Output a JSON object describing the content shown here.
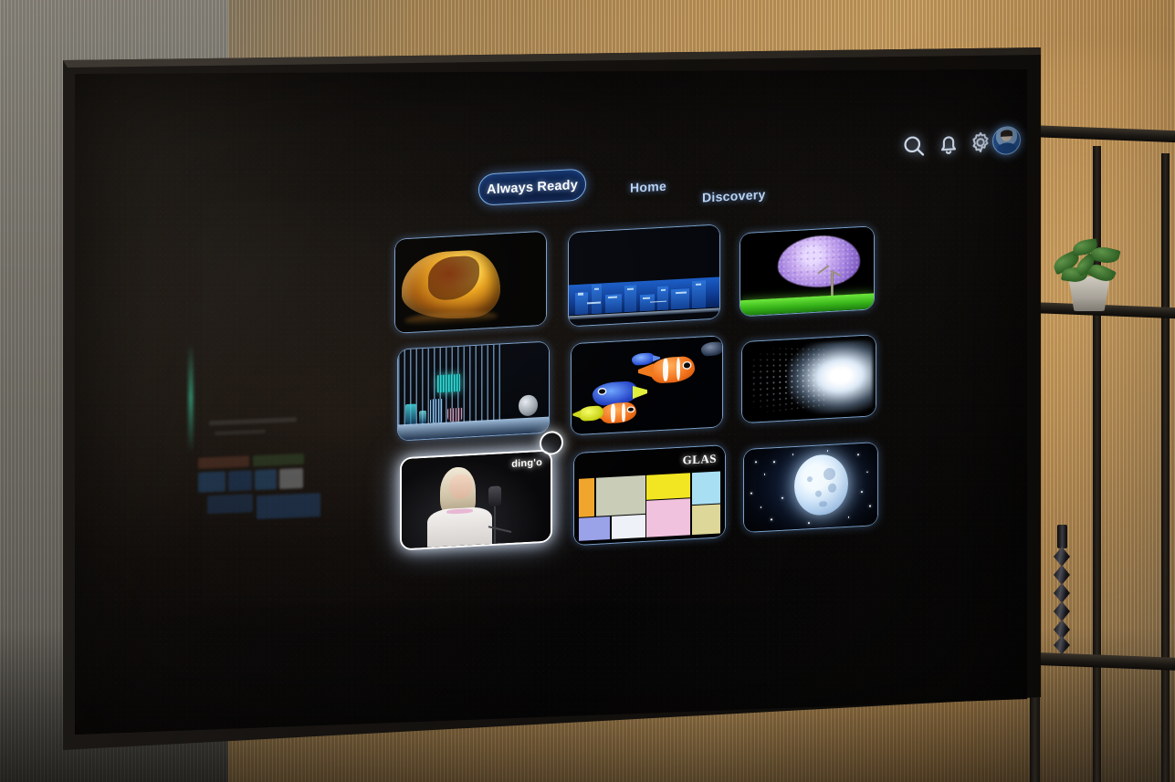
{
  "scene": {
    "description": "Television displaying Always Ready home screen on a black metal shelf unit",
    "wall_left_color": "#7d7a71",
    "wall_right_color": "#c99f62"
  },
  "topbar": {
    "pill_label": "Always Ready",
    "pill_border_color": "#7fb4ee",
    "pill_fill_color": "#0a1f49",
    "nav": [
      {
        "id": "home",
        "label": "Home"
      },
      {
        "id": "discovery",
        "label": "Discovery"
      }
    ],
    "nav_text_color": "#b9d3f5",
    "icons": [
      {
        "name": "search-icon",
        "label": "Search"
      },
      {
        "name": "bell-icon",
        "label": "Notifications"
      },
      {
        "name": "gear-icon",
        "label": "Settings"
      },
      {
        "name": "avatar",
        "label": "Profile"
      }
    ],
    "icon_color": "#dce9fb"
  },
  "grid": {
    "columns": 3,
    "rows": 3,
    "tiles": [
      {
        "id": "tile-food",
        "row": 1,
        "col": 1,
        "art": "honey-dessert-closeup",
        "badge": "",
        "selected": false
      },
      {
        "id": "tile-city",
        "row": 1,
        "col": 2,
        "art": "night-city-skyline",
        "badge": "",
        "selected": false
      },
      {
        "id": "tile-tree",
        "row": 1,
        "col": 3,
        "art": "purple-jacaranda-tree",
        "badge": "",
        "selected": false
      },
      {
        "id": "tile-interior",
        "row": 2,
        "col": 1,
        "art": "blue-lit-interior",
        "badge": "",
        "selected": false
      },
      {
        "id": "tile-aquarium",
        "row": 2,
        "col": 2,
        "art": "clownfish-aquarium",
        "badge": "",
        "selected": false
      },
      {
        "id": "tile-lighttunnel",
        "row": 2,
        "col": 3,
        "art": "white-light-tunnel",
        "badge": "",
        "selected": false
      },
      {
        "id": "tile-music",
        "row": 3,
        "col": 1,
        "art": "singer-with-microphone",
        "badge": "ding'o",
        "selected": true
      },
      {
        "id": "tile-glas",
        "row": 3,
        "col": 2,
        "art": "mondrian-color-blocks",
        "badge": "GLAS",
        "selected": false
      },
      {
        "id": "tile-moon",
        "row": 3,
        "col": 3,
        "art": "full-moon-starfield",
        "badge": "",
        "selected": false
      }
    ],
    "selected_border_color": "#ffffff",
    "tile_border_color": "#96c3f5"
  },
  "glas_palette": {
    "orange": "#f0a52c",
    "sage": "#c9cdb8",
    "yellow": "#f2e521",
    "lightblue": "#a9dff3",
    "pink": "#f0c2dd",
    "periwinkle": "#9aa2e8",
    "white": "#eef2f8",
    "khaki": "#ddd79a"
  },
  "room_objects": [
    {
      "name": "potted-plant",
      "location": "upper-right-shelf"
    },
    {
      "name": "candlestick",
      "location": "lower-right-shelf"
    }
  ]
}
